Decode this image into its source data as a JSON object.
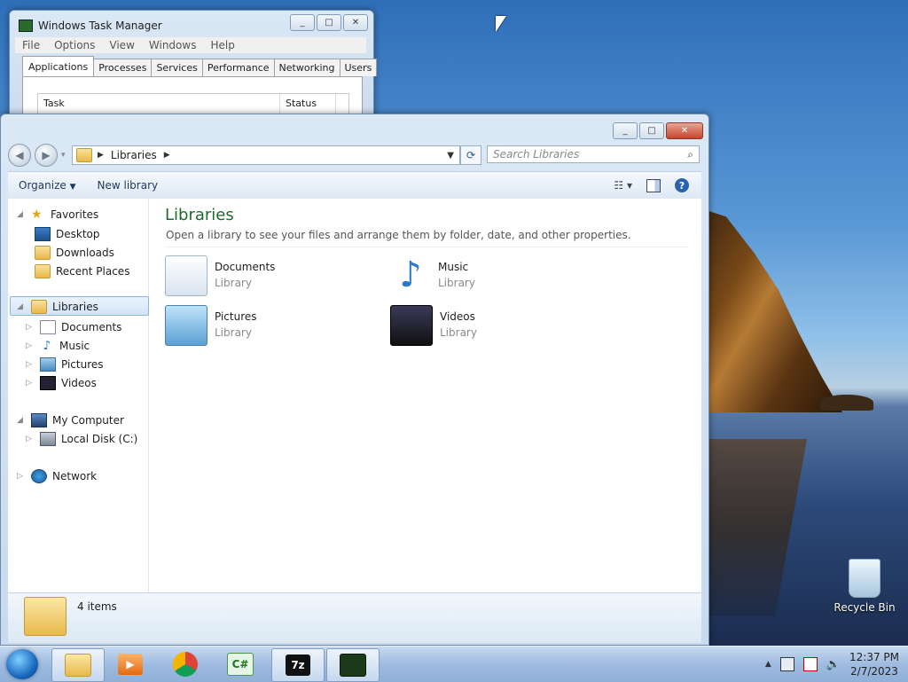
{
  "desktop": {
    "recycle_bin_label": "Recycle Bin"
  },
  "taskmgr": {
    "title": "Windows Task Manager",
    "menu": [
      "File",
      "Options",
      "View",
      "Windows",
      "Help"
    ],
    "tabs": [
      "Applications",
      "Processes",
      "Services",
      "Performance",
      "Networking",
      "Users"
    ],
    "active_tab": "Applications",
    "columns": [
      "Task",
      "Status"
    ]
  },
  "explorer": {
    "address": {
      "root_icon": "libraries-icon",
      "path": "Libraries"
    },
    "search_placeholder": "Search Libraries",
    "toolbar": {
      "organize": "Organize",
      "new_library": "New library"
    },
    "nav": {
      "favorites": {
        "label": "Favorites",
        "items": [
          "Desktop",
          "Downloads",
          "Recent Places"
        ]
      },
      "libraries": {
        "label": "Libraries",
        "items": [
          "Documents",
          "Music",
          "Pictures",
          "Videos"
        ]
      },
      "computer": {
        "label": "My Computer",
        "items": [
          "Local Disk (C:)"
        ]
      },
      "network": {
        "label": "Network"
      }
    },
    "content": {
      "title": "Libraries",
      "description": "Open a library to see your files and arrange them by folder, date, and other properties.",
      "libraries": [
        {
          "name": "Documents",
          "type": "Library",
          "icon": "documents-icon"
        },
        {
          "name": "Music",
          "type": "Library",
          "icon": "music-icon"
        },
        {
          "name": "Pictures",
          "type": "Library",
          "icon": "pictures-icon"
        },
        {
          "name": "Videos",
          "type": "Library",
          "icon": "videos-icon"
        }
      ]
    },
    "status": {
      "items_count": "4 items"
    }
  },
  "taskbar": {
    "apps": [
      "explorer",
      "media-player",
      "chrome",
      "csharp",
      "7zip",
      "task-manager"
    ],
    "clock": {
      "time": "12:37 PM",
      "date": "2/7/2023"
    }
  }
}
